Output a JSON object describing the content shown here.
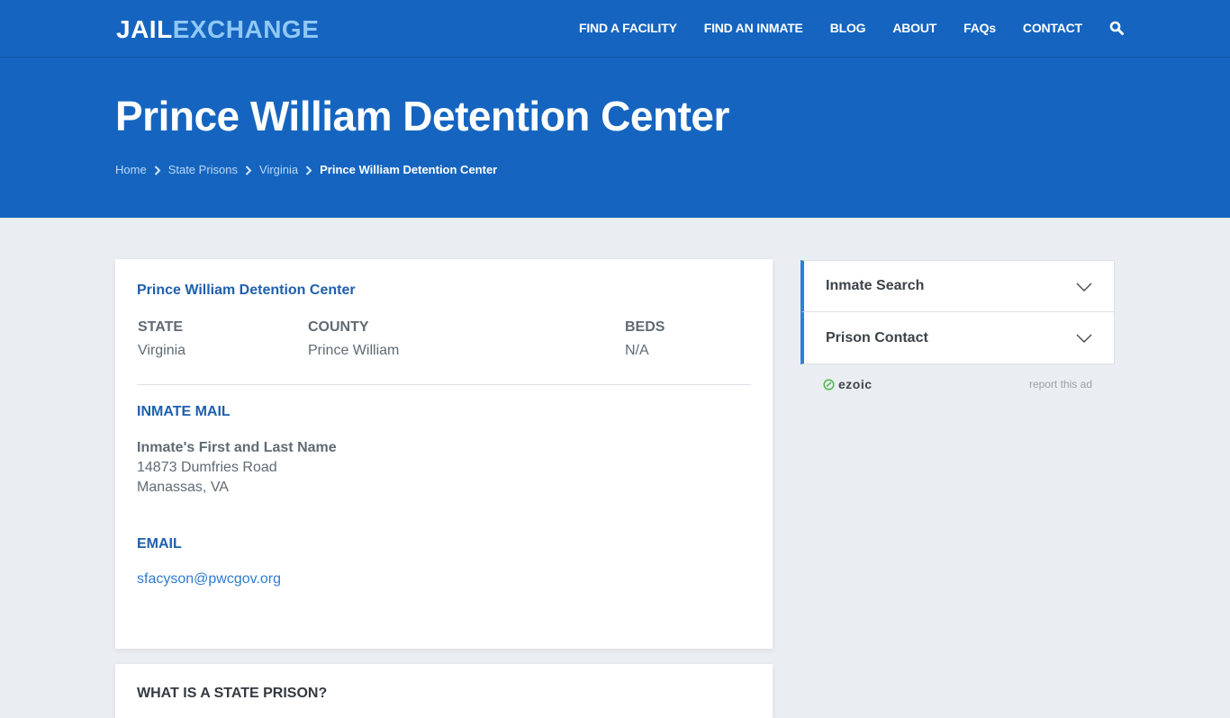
{
  "header": {
    "logo_part1": "JAIL",
    "logo_part2": "EXCHANGE",
    "nav": [
      {
        "label": "FIND A FACILITY"
      },
      {
        "label": "FIND AN INMATE"
      },
      {
        "label": "BLOG"
      },
      {
        "label": "ABOUT"
      },
      {
        "label": "FAQs"
      },
      {
        "label": "CONTACT"
      }
    ],
    "search_icon": "search-icon"
  },
  "hero": {
    "title": "Prince William Detention Center",
    "breadcrumb": [
      {
        "label": "Home"
      },
      {
        "label": "State Prisons"
      },
      {
        "label": "Virginia"
      },
      {
        "label": "Prince William Detention Center"
      }
    ]
  },
  "facility": {
    "name": "Prince William Detention Center",
    "fields": [
      {
        "label": "STATE",
        "value": "Virginia"
      },
      {
        "label": "COUNTY",
        "value": "Prince William"
      },
      {
        "label": "BEDS",
        "value": "N/A"
      }
    ],
    "mail": {
      "heading": "INMATE MAIL",
      "name_line": "Inmate's First and Last Name",
      "street": "14873 Dumfries Road",
      "city": "Manassas, VA"
    },
    "email": {
      "heading": "EMAIL",
      "address": "sfacyson@pwcgov.org"
    }
  },
  "next_section": {
    "heading": "WHAT IS A STATE PRISON?"
  },
  "sidebar": {
    "accordions": [
      {
        "label": "Inmate Search"
      },
      {
        "label": "Prison Contact"
      }
    ],
    "ad_brand": "ezoic",
    "ad_report": "report this ad"
  },
  "colors": {
    "brand_blue": "#1565c0",
    "logo_accent": "#90c8f5",
    "heading_blue": "#1f5fae",
    "link_blue": "#2e7bd0",
    "accordion_accent": "#2a82d8",
    "page_bg": "#eaeef2"
  }
}
